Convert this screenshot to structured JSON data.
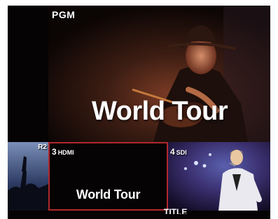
{
  "program": {
    "label": "PGM",
    "title": "World Tour"
  },
  "sources": [
    {
      "id": "r2",
      "label": "R2"
    },
    {
      "number": "3",
      "name": "HDMI",
      "title": "World Tour",
      "selected": true
    },
    {
      "number": "4",
      "name": "SDI"
    }
  ],
  "bottom": {
    "label": "TITLE"
  },
  "colors": {
    "selection_border": "#b0282c"
  }
}
